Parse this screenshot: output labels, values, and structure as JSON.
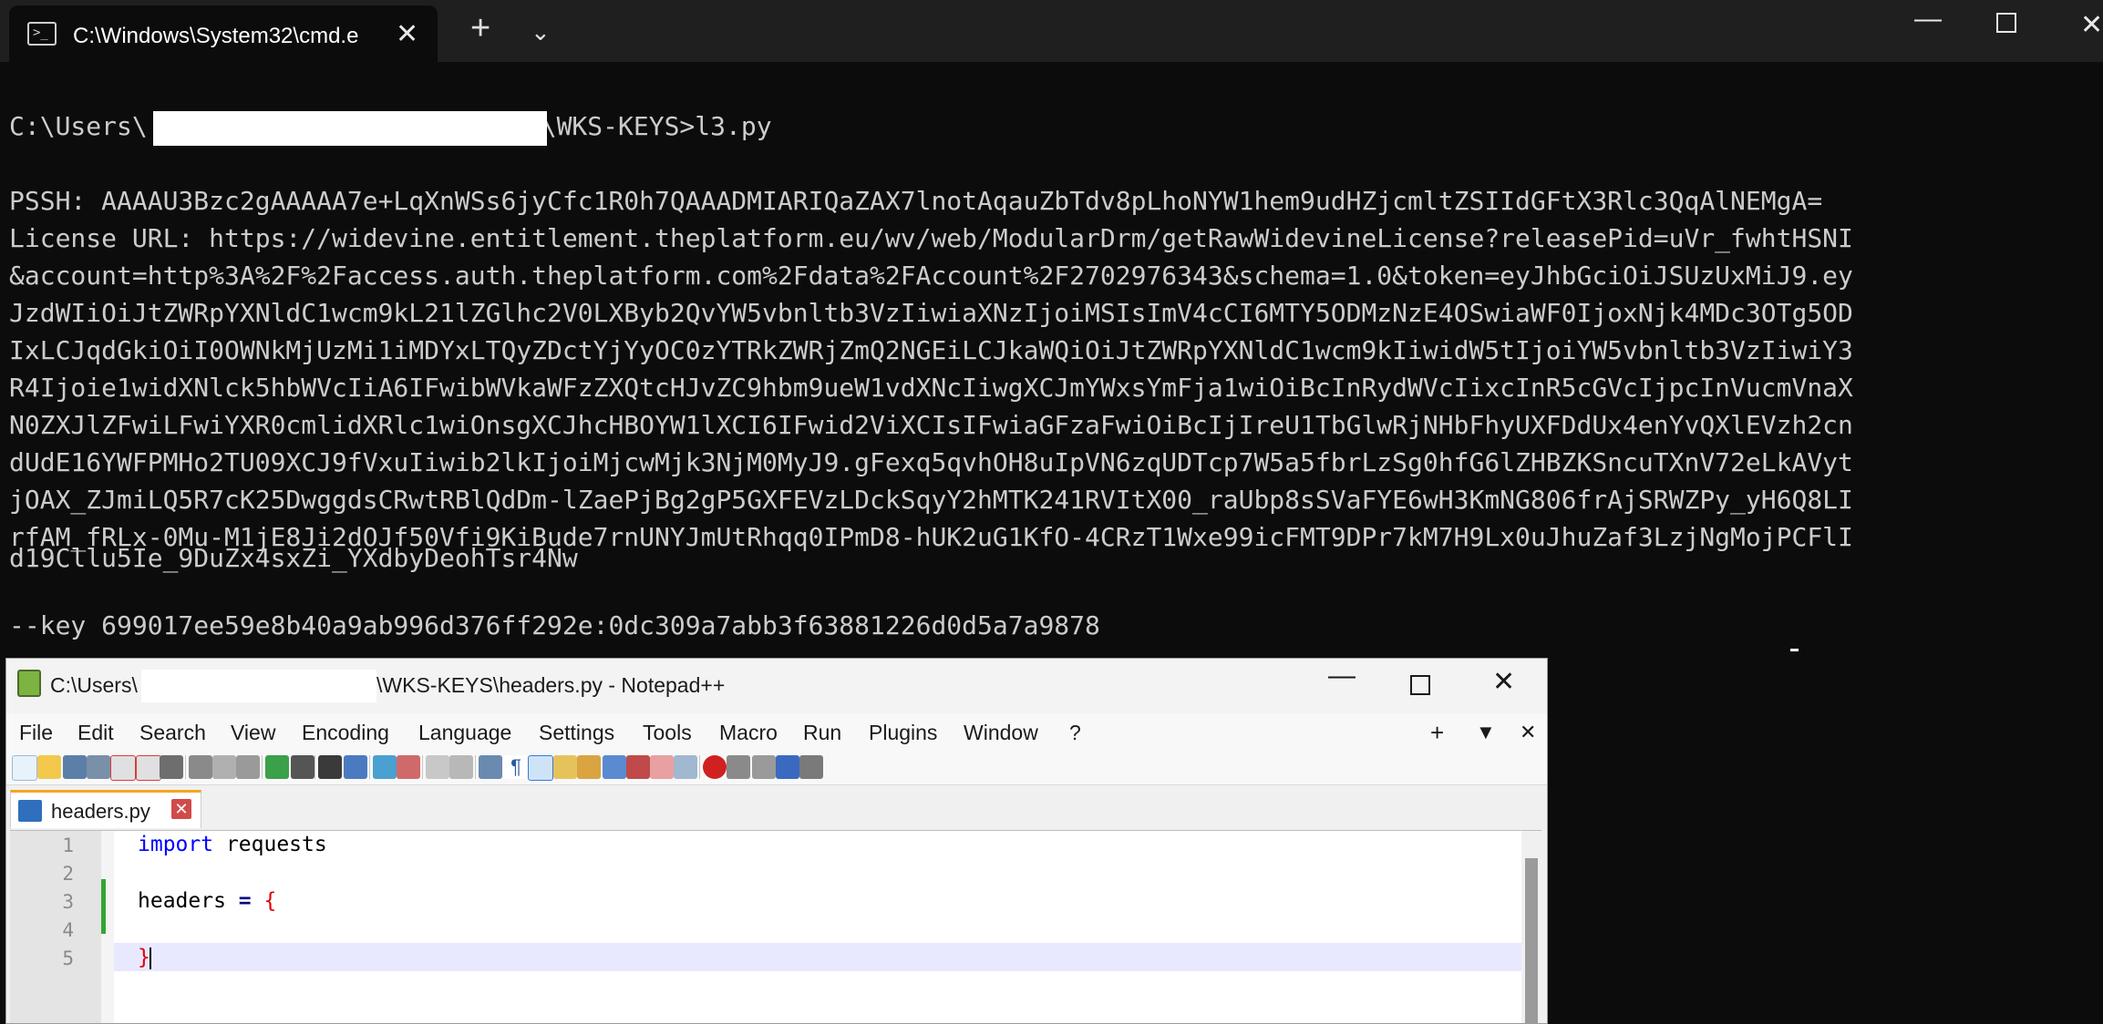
{
  "terminal": {
    "tab_title": "C:\\Windows\\System32\\cmd.e",
    "tab_icon": "terminal-icon",
    "prompt_prefix": "C:\\Users\\",
    "prompt_suffix": "\\WKS-KEYS>l3.py",
    "lines": [
      "PSSH: AAAAU3Bzc2gAAAAA7e+LqXnWSs6jyCfc1R0h7QAAADMIARIQaZAX7lnotAqauZbTdv8pLhoNYW1hem9udHZjcmltZSIIdGFtX3Rlc3QqAlNEMgA=",
      "License URL: https://widevine.entitlement.theplatform.eu/wv/web/ModularDrm/getRawWidevineLicense?releasePid=uVr_fwhtHSNI",
      "&account=http%3A%2F%2Faccess.auth.theplatform.com%2Fdata%2FAccount%2F2702976343&schema=1.0&token=eyJhbGciOiJSUzUxMiJ9.ey",
      "JzdWIiOiJtZWRpYXNldC1wcm9kL21lZGlhc2V0LXByb2QvYW5vbnltb3VzIiwiaXNzIjoiMSIsImV4cCI6MTY5ODMzNzE4OSwiaWF0IjoxNjk4MDc3OTg5OD",
      "IxLCJqdGkiOiI0OWNkMjUzMi1iMDYxLTQyZDctYjYyOC0zYTRkZWRjZmQ2NGEiLCJkaWQiOiJtZWRpYXNldC1wcm9kIiwidW5tIjoiYW5vbnltb3VzIiwiY3",
      "R4Ijoie1widXNlck5hbWVcIiA6IFwibWVkaWFzZXQtcHJvZC9hbm9ueW1vdXNcIiwgXCJmYWxsYmFja1wiOiBcInRydWVcIixcInR5cGVcIjpcInVucmVnaX",
      "N0ZXJlZFwiLFwiYXR0cmlidXRlc1wiOnsgXCJhcHBOYW1lXCI6IFwid2ViXCIsIFwiaGFzaFwiOiBcIjIreU1TbGlwRjNHbFhyUXFDdUx4enYvQXlEVzh2cn",
      "dUdE16YWFPMHo2TU09XCJ9fVxuIiwib2lkIjoiMjcwMjk3NjM0MyJ9.gFexq5qvhOH8uIpVN6zqUDTcp7W5a5fbrLzSg0hfG6lZHBZKSncuTXnV72eLkAVyt",
      "jOAX_ZJmiLQ5R7cK25DwggdsCRwtRBlQdDm-lZaePjBg2gP5GXFEVzLDckSqyY2hMTK241RVItX00_raUbp8sSVaFYE6wH3KmNG806frAjSRWZPy_yH6Q8LI",
      "rfAM_fRLx-0Mu-M1jE8Ji2dOJf50Vfi9KiBude7rnUNYJmUtRhqq0IPmD8-hUK2uG1KfO-4CRzT1Wxe99icFMT9DPr7kM7H9Lx0uJhuZaf3LzjNgMojPCFlI",
      "d19Cllu5Ie_9DuZx4sxZi_YXdbyDeohTsr4Nw"
    ],
    "key_line": "--key 699017ee59e8b40a9ab996d376ff292e:0dc309a7abb3f63881226d0d5a7a9878"
  },
  "notepad": {
    "title_prefix": "C:\\Users\\",
    "title_suffix": "\\WKS-KEYS\\headers.py - Notepad++",
    "menu": [
      "File",
      "Edit",
      "Search",
      "View",
      "Encoding",
      "Language",
      "Settings",
      "Tools",
      "Macro",
      "Run",
      "Plugins",
      "Window",
      "?"
    ],
    "menu_right": [
      "+",
      "▼",
      "✕"
    ],
    "tab_label": "headers.py",
    "line_numbers": [
      "1",
      "2",
      "3",
      "4",
      "5"
    ],
    "code": {
      "line1_kw": "import",
      "line1_rest": " requests",
      "line3_ident": "headers",
      "line3_op": "=",
      "line3_brace": "{",
      "line5_brace": "}"
    },
    "colors": {
      "accent_tab": "#f5a623",
      "keyword": "#0000ff",
      "brace": "#e00000",
      "change_bar": "#34a534"
    }
  }
}
